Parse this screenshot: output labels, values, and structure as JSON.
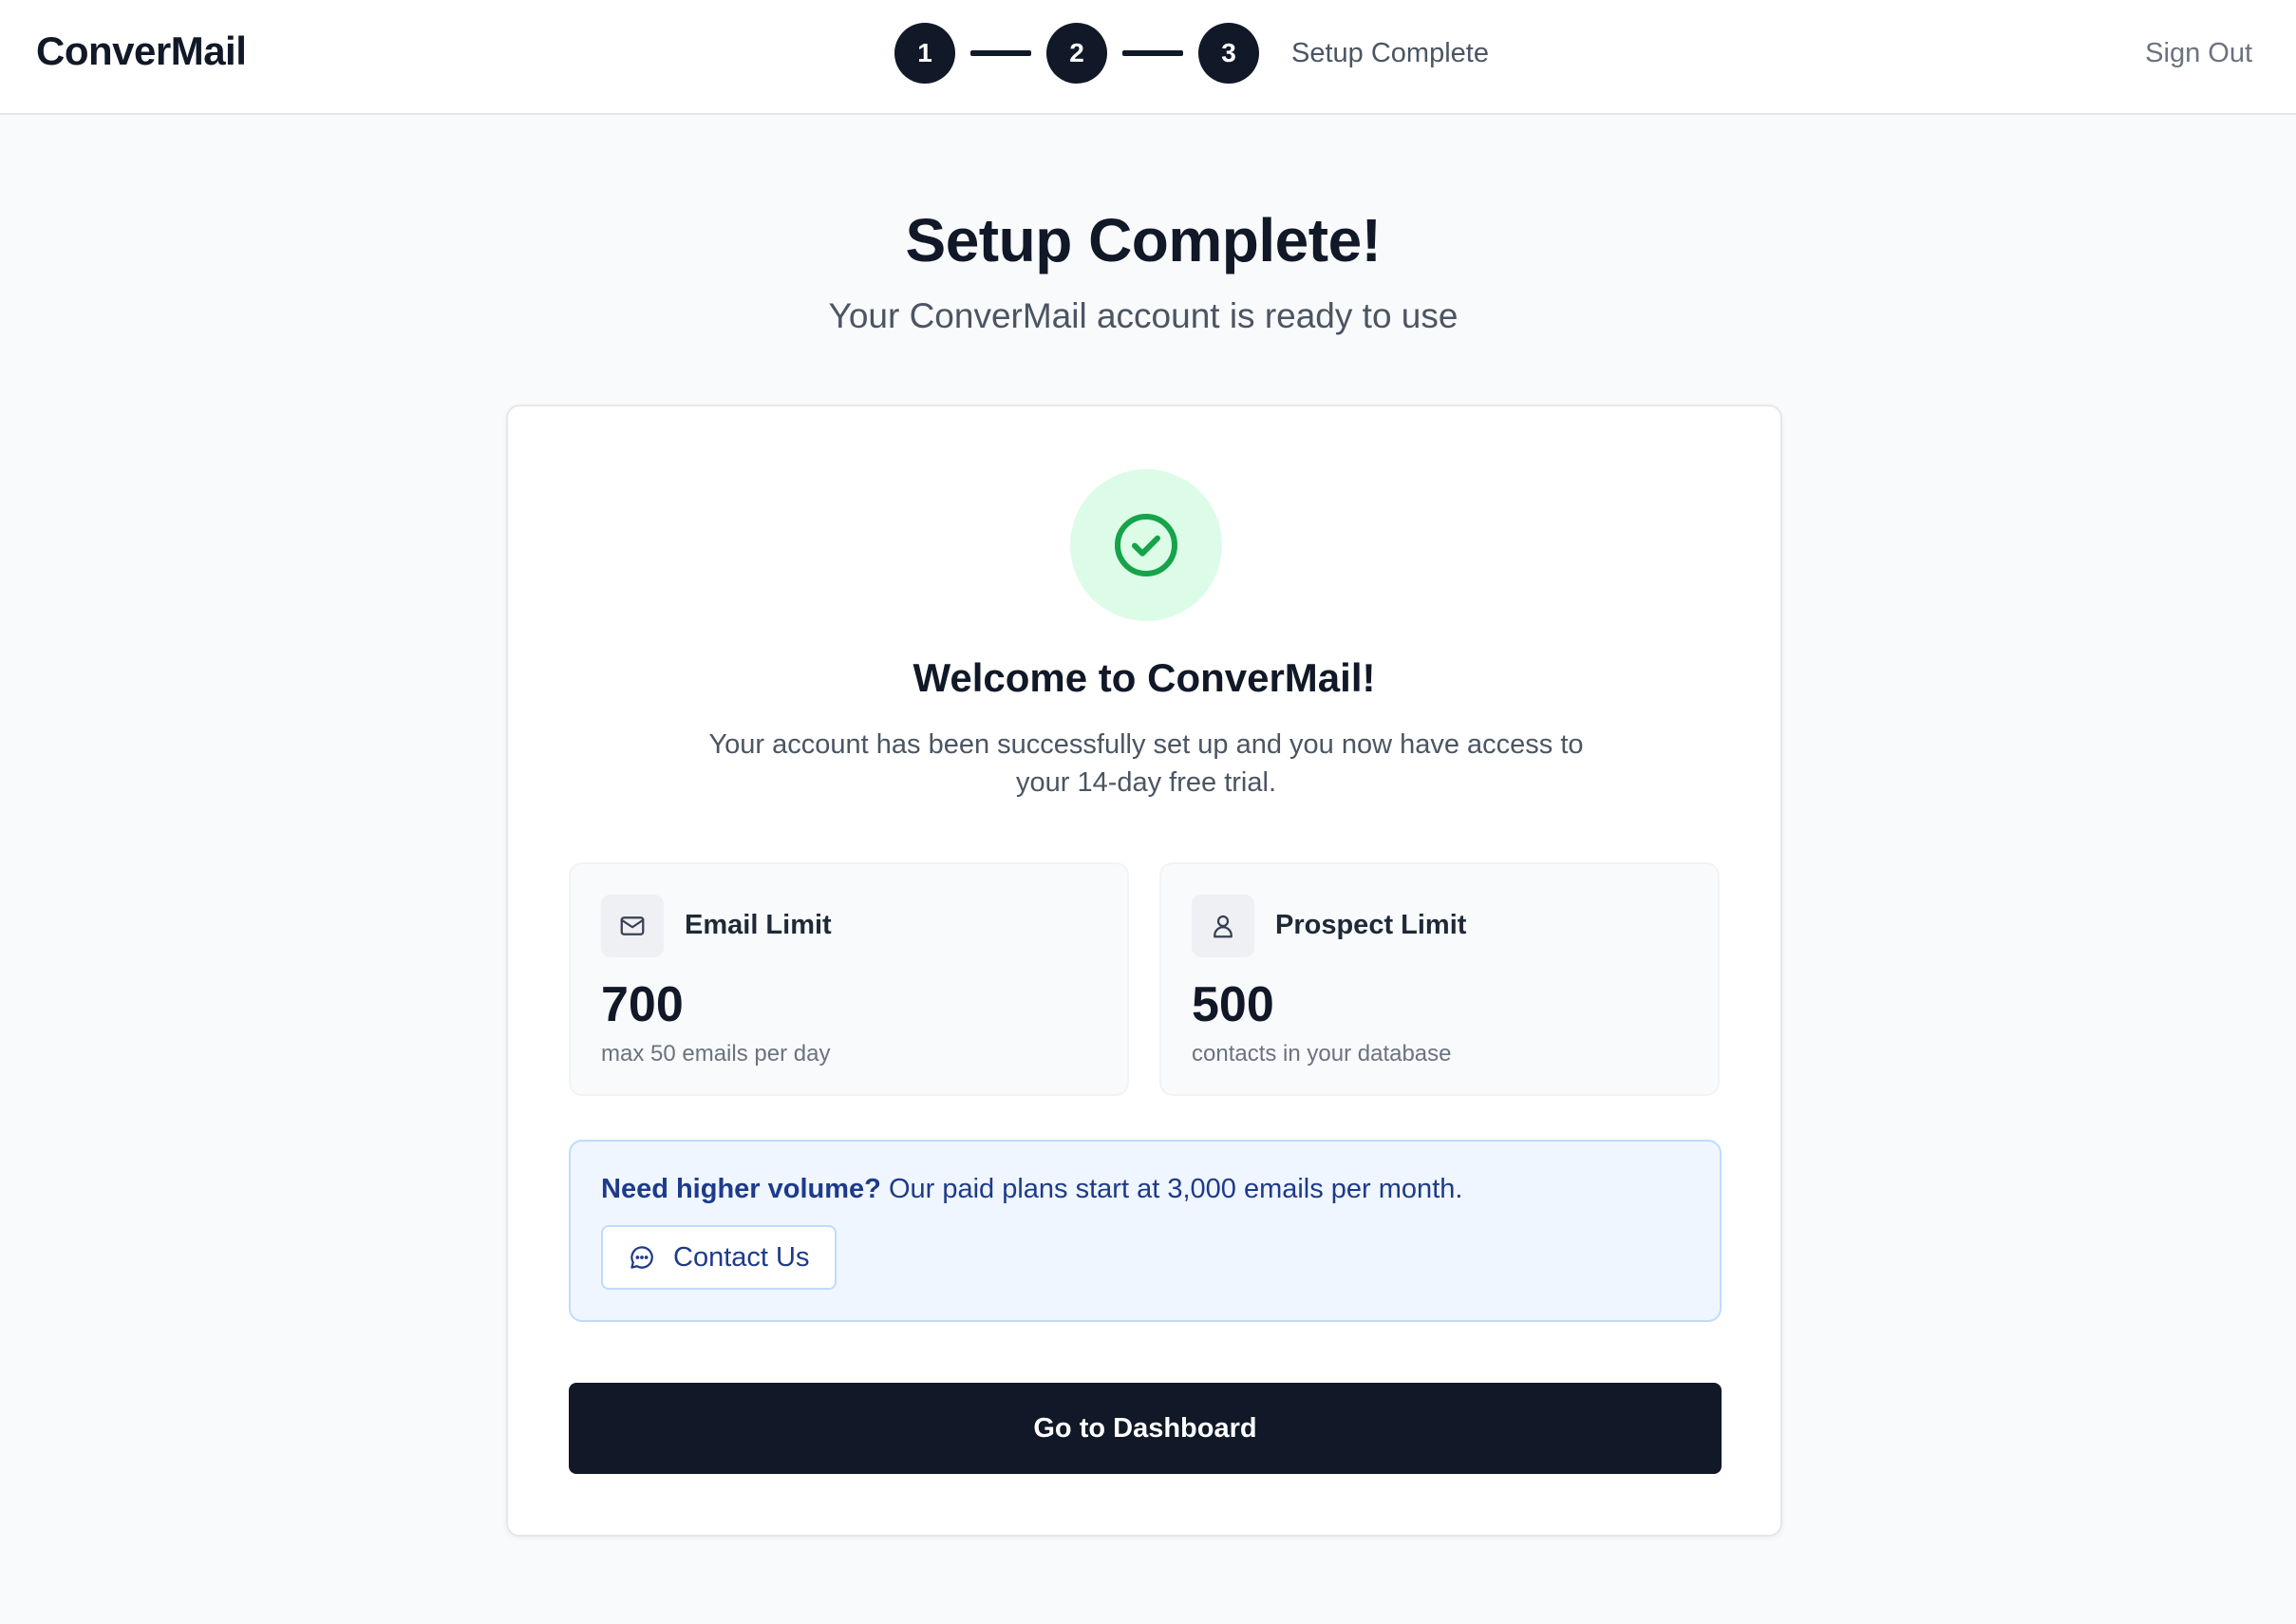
{
  "app": {
    "name": "ConverMail"
  },
  "header": {
    "steps": [
      "1",
      "2",
      "3"
    ],
    "current_step_label": "Setup Complete",
    "sign_out_label": "Sign Out"
  },
  "page": {
    "title": "Setup Complete!",
    "subtitle": "Your ConverMail account is ready to use"
  },
  "card": {
    "icon": "check-circle-icon",
    "welcome": "Welcome to ConverMail!",
    "description": "Your account has been successfully set up and you now have access to your 14-day free trial.",
    "limits": [
      {
        "icon": "mail-icon",
        "title": "Email Limit",
        "value": "700",
        "caption": "max 50 emails per day"
      },
      {
        "icon": "user-icon",
        "title": "Prospect Limit",
        "value": "500",
        "caption": "contacts in your database"
      }
    ],
    "promo": {
      "bold": "Need higher volume?",
      "text": " Our paid plans start at 3,000 emails per month.",
      "contact_label": "Contact Us",
      "contact_icon": "chat-bubble-icon"
    },
    "dashboard_label": "Go to Dashboard"
  },
  "colors": {
    "primary": "#111827",
    "success": "#16a34a",
    "success_bg": "#dcfce7",
    "promo_bg": "#eff6ff",
    "promo_text": "#1e3a8a"
  }
}
